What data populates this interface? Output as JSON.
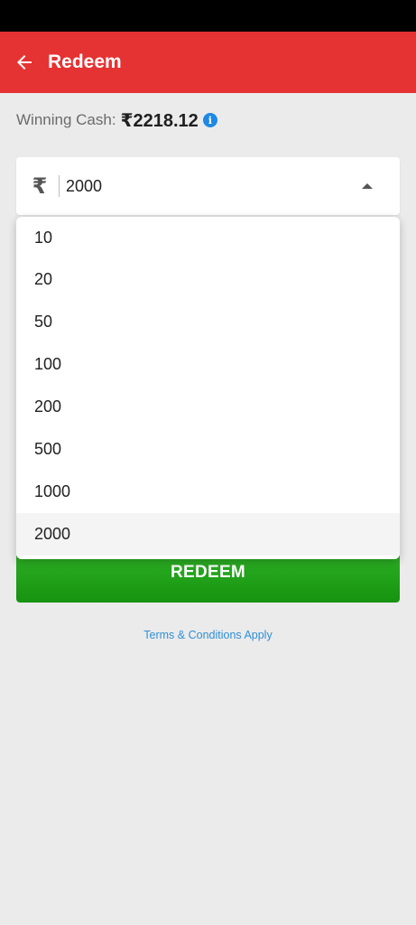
{
  "header": {
    "title": "Redeem"
  },
  "wallet": {
    "winning_label": "Winning Cash:",
    "winning_amount": "₹2218.12"
  },
  "amount_select": {
    "currency_symbol": "₹",
    "selected_value": "2000",
    "options": [
      "10",
      "20",
      "50",
      "100",
      "200",
      "500",
      "1000",
      "2000"
    ]
  },
  "actions": {
    "redeem_label": "REDEEM",
    "terms_label": "Terms & Conditions Apply"
  },
  "colors": {
    "header_bg": "#e53232",
    "button_green": "#1ea11a",
    "link_blue": "#2f8fd8",
    "info_blue": "#1e88e5"
  },
  "icons": {
    "back": "back-arrow-icon",
    "info": "info-icon",
    "currency": "rupee-icon",
    "caret": "caret-up-icon"
  }
}
